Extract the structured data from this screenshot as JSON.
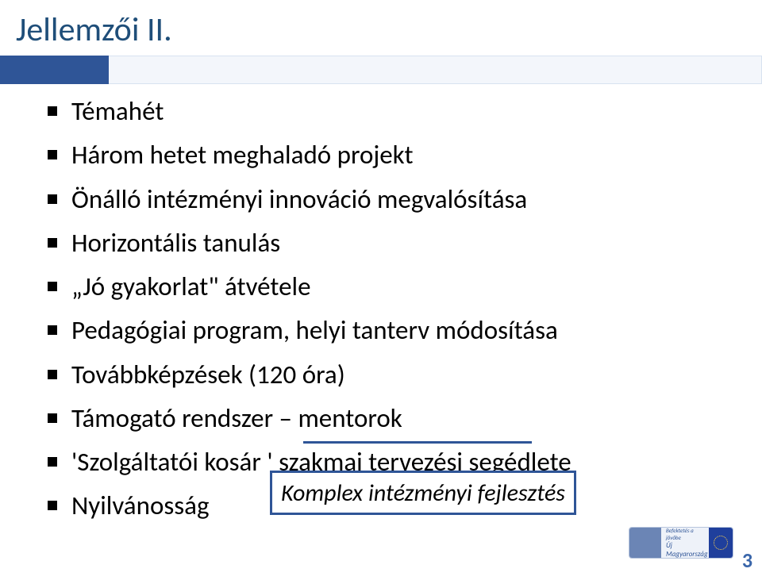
{
  "title": "Jellemzői II.",
  "bullets": [
    "Témahét",
    "Három hetet meghaladó projekt",
    "Önálló intézményi innováció megvalósítása",
    "Horizontális tanulás",
    "„Jó gyakorlat\" átvétele",
    "Pedagógiai program, helyi tanterv  módosítása",
    "Továbbképzések (120 óra)",
    "Támogató rendszer – mentorok",
    "'Szolgáltatói kosár ' szakmai tervezési segédlete",
    "Nyilvánosság"
  ],
  "caption": "Komplex intézményi fejlesztés",
  "badge": {
    "line1": "Befektetés a jövőbe",
    "line2": "Új Magyarország"
  },
  "page_number": "3"
}
